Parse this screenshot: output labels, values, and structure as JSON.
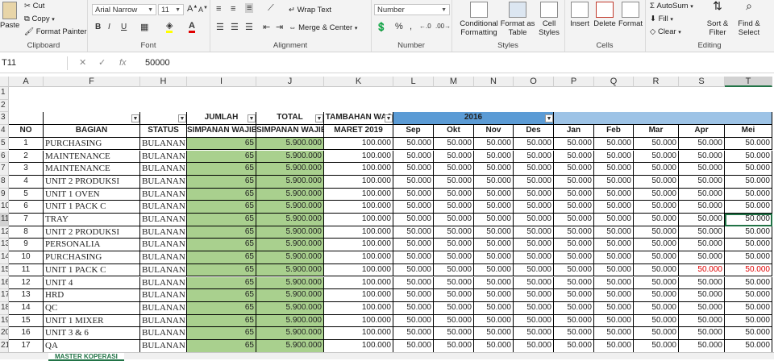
{
  "ribbon": {
    "clipboard": {
      "paste": "Paste",
      "cut": "Cut",
      "copy": "Copy",
      "format_painter": "Format Painter",
      "label": "Clipboard"
    },
    "font": {
      "name": "Arial Narrow",
      "size": "11",
      "bold": "B",
      "italic": "I",
      "underline": "U",
      "label": "Font"
    },
    "alignment": {
      "wrap_text": "Wrap Text",
      "merge_center": "Merge & Center",
      "label": "Alignment"
    },
    "number": {
      "format": "Number",
      "label": "Number"
    },
    "styles": {
      "conditional": "Conditional\nFormatting",
      "format_table": "Format as\nTable",
      "cell_styles": "Cell\nStyles",
      "label": "Styles"
    },
    "cells": {
      "insert": "Insert",
      "delete": "Delete",
      "format": "Format",
      "label": "Cells"
    },
    "editing": {
      "autosum": "AutoSum",
      "fill": "Fill",
      "clear": "Clear",
      "sort_filter": "Sort &\nFilter",
      "find_select": "Find &\nSelect",
      "label": "Editing"
    }
  },
  "formula_bar": {
    "name_box": "T11",
    "fx": "fx",
    "value": "50000"
  },
  "columns": [
    "A",
    "F",
    "H",
    "I",
    "J",
    "K",
    "L",
    "M",
    "N",
    "O",
    "P",
    "Q",
    "R",
    "S",
    "T"
  ],
  "row_numbers": [
    "1",
    "2",
    "3",
    "4",
    "5",
    "6",
    "7",
    "8",
    "9",
    "10",
    "11",
    "12",
    "13",
    "14",
    "15",
    "16",
    "17",
    "18",
    "19",
    "20",
    "21"
  ],
  "headers": {
    "no": "NO",
    "bagian": "BAGIAN",
    "status": "STATUS",
    "jumlah_1": "JUMLAH",
    "jumlah_2": "SIMPANAN WAJIB",
    "total_1": "TOTAL",
    "total_2": "SIMPANAN WAJIB",
    "tambahan_1": "TAMBAHAN WAJ",
    "tambahan_2": "MARET 2019",
    "year": "2016",
    "months": [
      "Sep",
      "Okt",
      "Nov",
      "Des",
      "Jan",
      "Feb",
      "Mar",
      "Apr",
      "Mei"
    ]
  },
  "rows": [
    {
      "no": "1",
      "bagian": "PURCHASING",
      "status": "BULANAN",
      "jumlah": "65",
      "total": "5.900.000",
      "tambahan": "100.000",
      "months": [
        "50.000",
        "50.000",
        "50.000",
        "50.000",
        "50.000",
        "50.000",
        "50.000",
        "50.000",
        "50.000"
      ]
    },
    {
      "no": "2",
      "bagian": "MAINTENANCE",
      "status": "BULANAN",
      "jumlah": "65",
      "total": "5.900.000",
      "tambahan": "100.000",
      "months": [
        "50.000",
        "50.000",
        "50.000",
        "50.000",
        "50.000",
        "50.000",
        "50.000",
        "50.000",
        "50.000"
      ]
    },
    {
      "no": "3",
      "bagian": "MAINTENANCE",
      "status": "BULANAN",
      "jumlah": "65",
      "total": "5.900.000",
      "tambahan": "100.000",
      "months": [
        "50.000",
        "50.000",
        "50.000",
        "50.000",
        "50.000",
        "50.000",
        "50.000",
        "50.000",
        "50.000"
      ]
    },
    {
      "no": "4",
      "bagian": "UNIT 2 PRODUKSI",
      "status": "BULANAN",
      "jumlah": "65",
      "total": "5.900.000",
      "tambahan": "100.000",
      "months": [
        "50.000",
        "50.000",
        "50.000",
        "50.000",
        "50.000",
        "50.000",
        "50.000",
        "50.000",
        "50.000"
      ]
    },
    {
      "no": "5",
      "bagian": "UNIT 1 OVEN",
      "status": "BULANAN",
      "jumlah": "65",
      "total": "5.900.000",
      "tambahan": "100.000",
      "months": [
        "50.000",
        "50.000",
        "50.000",
        "50.000",
        "50.000",
        "50.000",
        "50.000",
        "50.000",
        "50.000"
      ]
    },
    {
      "no": "6",
      "bagian": "UNIT 1 PACK C",
      "status": "BULANAN",
      "jumlah": "65",
      "total": "5.900.000",
      "tambahan": "100.000",
      "months": [
        "50.000",
        "50.000",
        "50.000",
        "50.000",
        "50.000",
        "50.000",
        "50.000",
        "50.000",
        "50.000"
      ]
    },
    {
      "no": "7",
      "bagian": "TRAY",
      "status": "BULANAN",
      "jumlah": "65",
      "total": "5.900.000",
      "tambahan": "100.000",
      "months": [
        "50.000",
        "50.000",
        "50.000",
        "50.000",
        "50.000",
        "50.000",
        "50.000",
        "50.000",
        "50.000"
      ]
    },
    {
      "no": "8",
      "bagian": "UNIT 2 PRODUKSI",
      "status": "BULANAN",
      "jumlah": "65",
      "total": "5.900.000",
      "tambahan": "100.000",
      "months": [
        "50.000",
        "50.000",
        "50.000",
        "50.000",
        "50.000",
        "50.000",
        "50.000",
        "50.000",
        "50.000"
      ]
    },
    {
      "no": "9",
      "bagian": "PERSONALIA",
      "status": "BULANAN",
      "jumlah": "65",
      "total": "5.900.000",
      "tambahan": "100.000",
      "months": [
        "50.000",
        "50.000",
        "50.000",
        "50.000",
        "50.000",
        "50.000",
        "50.000",
        "50.000",
        "50.000"
      ]
    },
    {
      "no": "10",
      "bagian": "PURCHASING",
      "status": "BULANAN",
      "jumlah": "65",
      "total": "5.900.000",
      "tambahan": "100.000",
      "months": [
        "50.000",
        "50.000",
        "50.000",
        "50.000",
        "50.000",
        "50.000",
        "50.000",
        "50.000",
        "50.000"
      ]
    },
    {
      "no": "11",
      "bagian": "UNIT 1 PACK C",
      "status": "BULANAN",
      "jumlah": "65",
      "total": "5.900.000",
      "tambahan": "100.000",
      "months": [
        "50.000",
        "50.000",
        "50.000",
        "50.000",
        "50.000",
        "50.000",
        "50.000",
        "50.000",
        "50.000"
      ],
      "red": [
        7,
        8
      ]
    },
    {
      "no": "12",
      "bagian": "UNIT 4",
      "status": "BULANAN",
      "jumlah": "65",
      "total": "5.900.000",
      "tambahan": "100.000",
      "months": [
        "50.000",
        "50.000",
        "50.000",
        "50.000",
        "50.000",
        "50.000",
        "50.000",
        "50.000",
        "50.000"
      ]
    },
    {
      "no": "13",
      "bagian": "HRD",
      "status": "BULANAN",
      "jumlah": "65",
      "total": "5.900.000",
      "tambahan": "100.000",
      "months": [
        "50.000",
        "50.000",
        "50.000",
        "50.000",
        "50.000",
        "50.000",
        "50.000",
        "50.000",
        "50.000"
      ]
    },
    {
      "no": "14",
      "bagian": "QC",
      "status": "BULANAN",
      "jumlah": "65",
      "total": "5.900.000",
      "tambahan": "100.000",
      "months": [
        "50.000",
        "50.000",
        "50.000",
        "50.000",
        "50.000",
        "50.000",
        "50.000",
        "50.000",
        "50.000"
      ]
    },
    {
      "no": "15",
      "bagian": "UNIT 1 MIXER",
      "status": "BULANAN",
      "jumlah": "65",
      "total": "5.900.000",
      "tambahan": "100.000",
      "months": [
        "50.000",
        "50.000",
        "50.000",
        "50.000",
        "50.000",
        "50.000",
        "50.000",
        "50.000",
        "50.000"
      ]
    },
    {
      "no": "16",
      "bagian": "UNIT 3 & 6",
      "status": "BULANAN",
      "jumlah": "65",
      "total": "5.900.000",
      "tambahan": "100.000",
      "months": [
        "50.000",
        "50.000",
        "50.000",
        "50.000",
        "50.000",
        "50.000",
        "50.000",
        "50.000",
        "50.000"
      ]
    },
    {
      "no": "17",
      "bagian": "QA",
      "status": "BULANAN",
      "jumlah": "65",
      "total": "5.900.000",
      "tambahan": "100.000",
      "months": [
        "50.000",
        "50.000",
        "50.000",
        "50.000",
        "50.000",
        "50.000",
        "50.000",
        "50.000",
        "50.000"
      ]
    }
  ],
  "sheet_tab": "MASTER KOPERASI",
  "colors": {
    "green_fill": "#a9d08e",
    "header_blue": "#5b9bd5",
    "light_blue": "#9dc3e6",
    "negative_red": "#e00000",
    "excel_green": "#217346"
  }
}
